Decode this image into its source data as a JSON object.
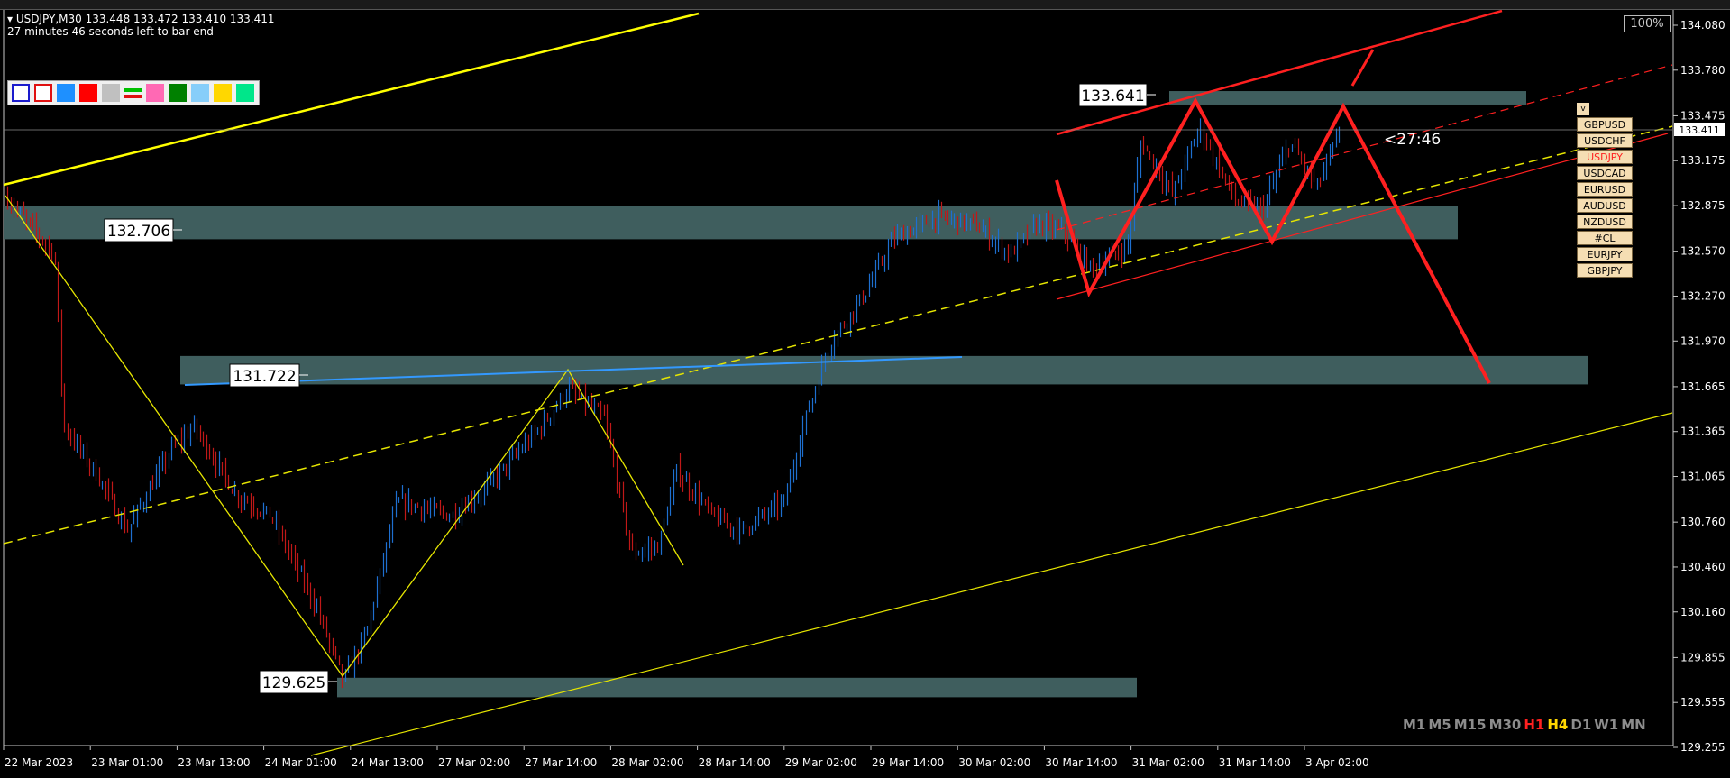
{
  "header": {
    "symbol_line": "USDJPY,M30  133.448 133.472 133.410 133.411",
    "time_left": "27 minutes 46 seconds left to bar end",
    "zoom": "100%"
  },
  "palette_colors": [
    "#ffffff",
    "#ffffff",
    "#1e90ff",
    "#ff0000",
    "#c0c0c0",
    "#00ff00",
    "#ff69b4",
    "#008000",
    "#87cefa",
    "#ffd700",
    "#00e68a"
  ],
  "symbols": {
    "toggle": "v",
    "items": [
      "GBPUSD",
      "USDCHF",
      "USDJPY",
      "USDCAD",
      "EURUSD",
      "AUDUSD",
      "NZDUSD",
      "#CL",
      "EURJPY",
      "GBPJPY"
    ],
    "active": "USDJPY"
  },
  "timeframes": [
    {
      "label": "M1",
      "color": "#8c8c8c"
    },
    {
      "label": "M5",
      "color": "#8c8c8c"
    },
    {
      "label": "M15",
      "color": "#8c8c8c"
    },
    {
      "label": "M30",
      "color": "#8c8c8c"
    },
    {
      "label": "H1",
      "color": "#ff2020"
    },
    {
      "label": "H4",
      "color": "#ffd700"
    },
    {
      "label": "D1",
      "color": "#8c8c8c"
    },
    {
      "label": "W1",
      "color": "#8c8c8c"
    },
    {
      "label": "MN",
      "color": "#8c8c8c"
    }
  ],
  "chart_data": {
    "type": "candlestick",
    "symbol": "USDJPY",
    "timeframe": "M30",
    "y_ticks": [
      "134.080",
      "133.780",
      "133.475",
      "133.175",
      "132.875",
      "132.570",
      "132.270",
      "131.970",
      "131.665",
      "131.365",
      "131.065",
      "130.760",
      "130.460",
      "130.160",
      "129.855",
      "129.555",
      "129.255"
    ],
    "x_ticks": [
      "22 Mar 2023",
      "23 Mar 01:00",
      "23 Mar 13:00",
      "24 Mar 01:00",
      "24 Mar 13:00",
      "27 Mar 02:00",
      "27 Mar 14:00",
      "28 Mar 02:00",
      "28 Mar 14:00",
      "29 Mar 02:00",
      "29 Mar 14:00",
      "30 Mar 02:00",
      "30 Mar 14:00",
      "31 Mar 02:00",
      "31 Mar 14:00",
      "3 Apr 02:00"
    ],
    "ylim": [
      129.2,
      134.2
    ],
    "current_price": "133.411",
    "countdown": "<27:46",
    "price_labels": [
      "133.641",
      "132.706",
      "131.722",
      "129.625"
    ],
    "zones": [
      {
        "low": 132.65,
        "high": 132.87,
        "color": "#3f5e5e"
      },
      {
        "low": 131.68,
        "high": 131.87,
        "color": "#3f5e5e"
      },
      {
        "low": 129.59,
        "high": 129.72,
        "color": "#3f5e5e"
      },
      {
        "low": 133.55,
        "high": 133.64,
        "color": "#3f5e5e"
      }
    ],
    "bull_color": "#1e6fd0",
    "bear_color": "#c01818"
  }
}
